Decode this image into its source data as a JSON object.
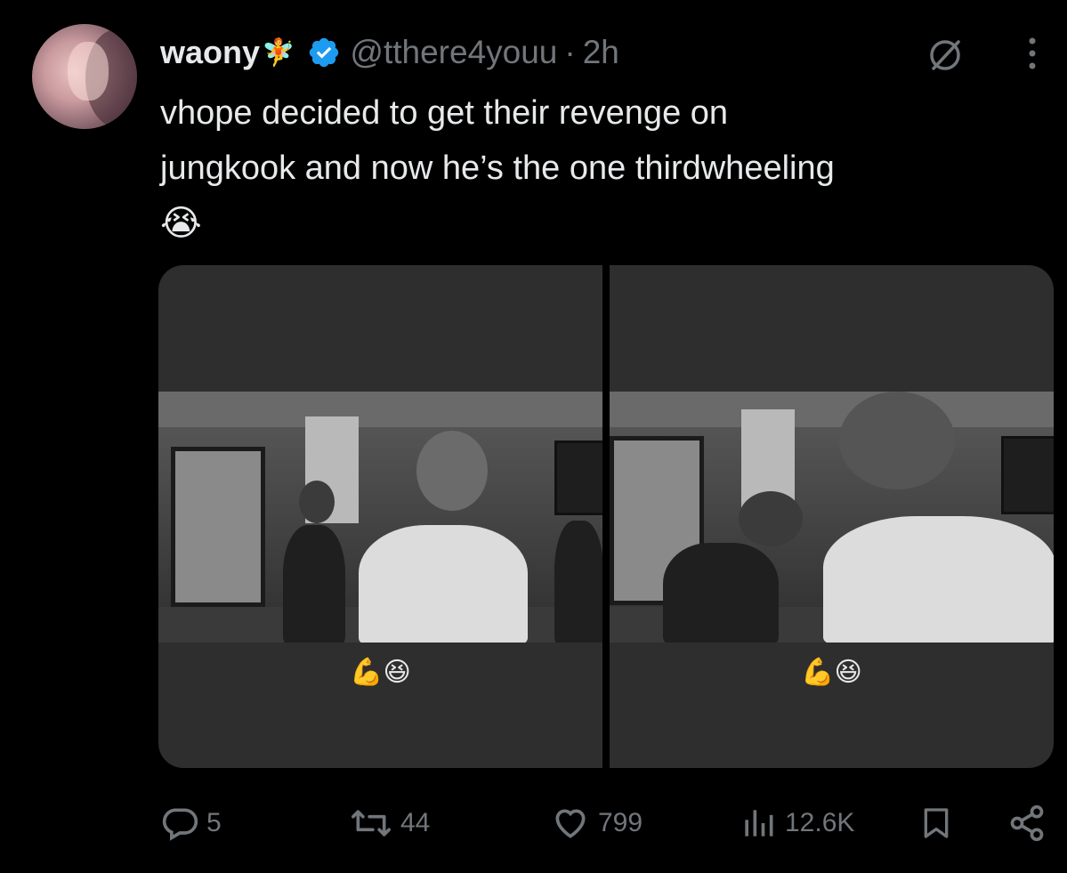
{
  "tweet": {
    "author_name": "waony",
    "name_emoji": "🧚",
    "handle": "@tthere4youu",
    "separator": "·",
    "time": "2h",
    "text_line1": "vhope decided to get their revenge on",
    "text_line2": "jungkook and now he’s the one thirdwheeling",
    "text_emoji": "😭",
    "media": [
      {
        "caption_emoji": "💪😆"
      },
      {
        "caption_emoji": "💪😆"
      }
    ]
  },
  "actions": {
    "replies": "5",
    "reposts": "44",
    "likes": "799",
    "views": "12.6K"
  },
  "colors": {
    "background": "#000000",
    "text": "#e7e9ea",
    "muted": "#71767b",
    "verified": "#1d9bf0",
    "media_bg": "#2e2e2e"
  },
  "icons": [
    "verified-badge-icon",
    "grok-icon",
    "more-icon",
    "reply-icon",
    "repost-icon",
    "like-icon",
    "views-icon",
    "bookmark-icon",
    "share-icon"
  ]
}
